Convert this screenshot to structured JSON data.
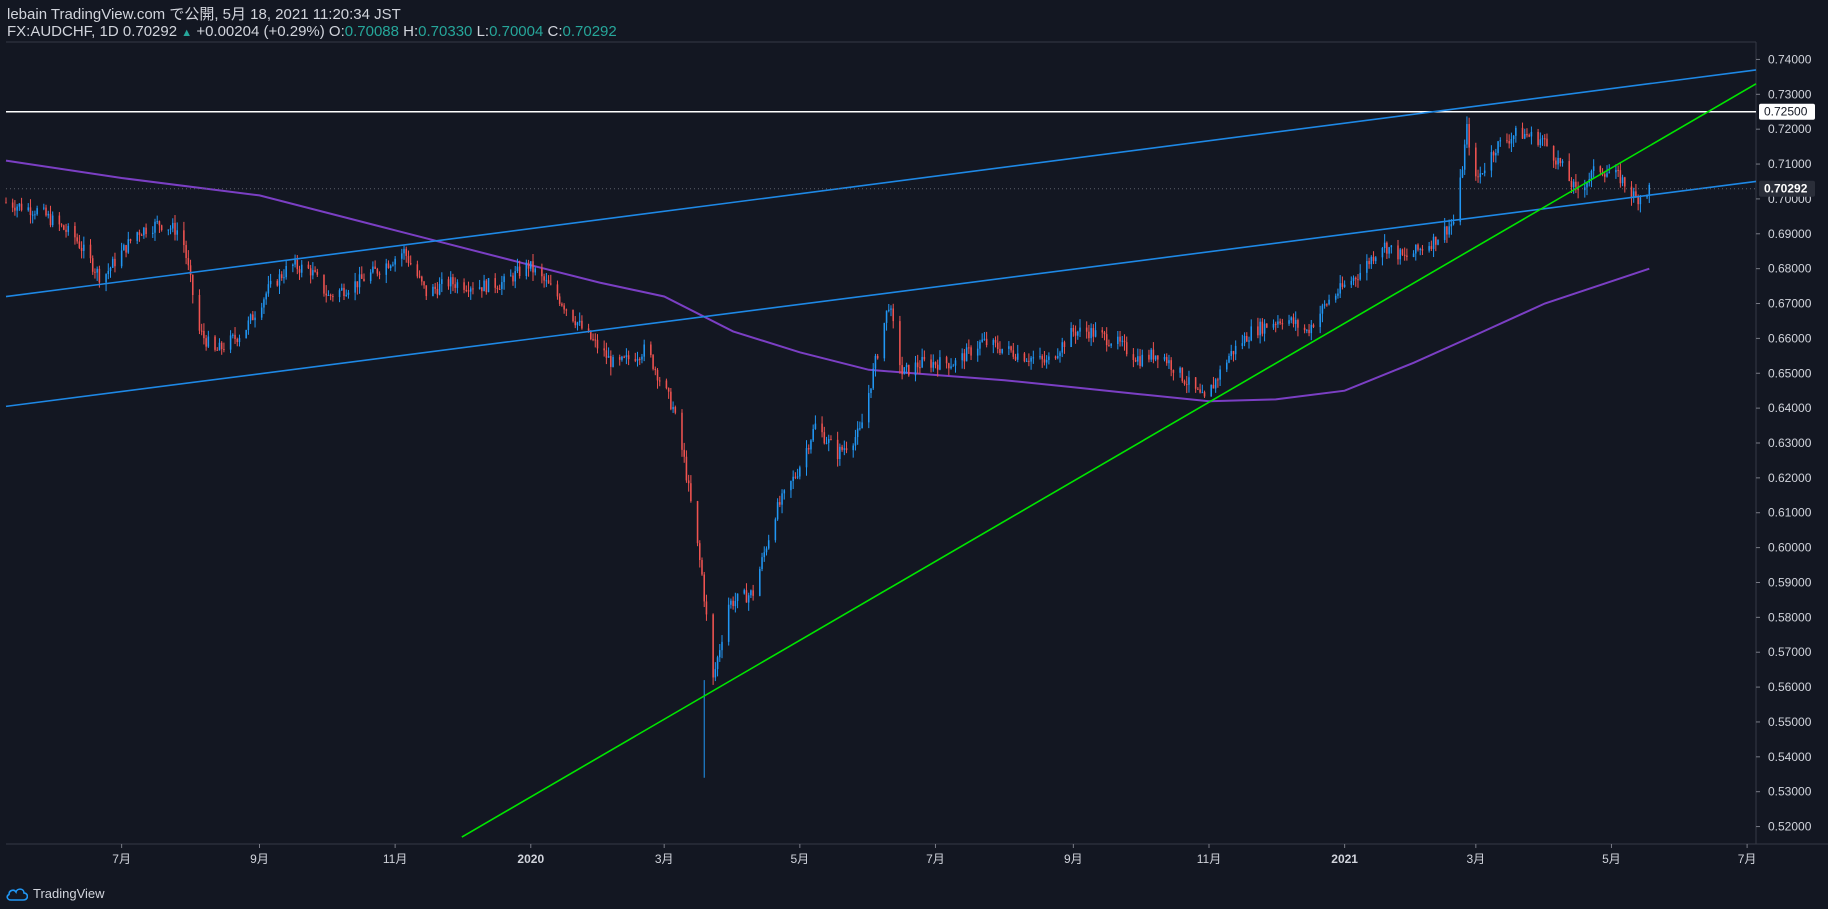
{
  "header": {
    "line1": "lebain TradingView.com で公開, 5月 18, 2021 11:20:34 JST",
    "symbol": "FX:AUDCHF, 1D 0.70292",
    "change_arrow": "▲",
    "change": "+0.00204 (+0.29%)",
    "o_label": "O:",
    "o_value": "0.70088",
    "h_label": "H:",
    "h_value": "0.70330",
    "l_label": "L:",
    "l_value": "0.70004",
    "c_label": "C:",
    "c_value": "0.70292"
  },
  "footer": {
    "brand": "TradingView"
  },
  "colors": {
    "background": "#131722",
    "up": "#2196f3",
    "down": "#ef5350",
    "ma": "#7b3fc4",
    "channel": "#1e88e5",
    "trend": "#00e600",
    "hline": "#ffffff",
    "axis_text": "#d1d4dc",
    "green_text": "#26a69a"
  },
  "chart_data": {
    "type": "candlestick",
    "symbol": "FX:AUDCHF",
    "interval": "1D",
    "ylim": [
      0.515,
      0.745
    ],
    "y_ticks": [
      "0.74000",
      "0.73000",
      "0.72000",
      "0.71000",
      "0.70000",
      "0.69000",
      "0.68000",
      "0.67000",
      "0.66000",
      "0.65000",
      "0.64000",
      "0.63000",
      "0.62000",
      "0.61000",
      "0.60000",
      "0.59000",
      "0.58000",
      "0.57000",
      "0.56000",
      "0.55000",
      "0.54000",
      "0.53000",
      "0.52000"
    ],
    "x_range": [
      "2019-05-10",
      "2021-07-05"
    ],
    "x_ticks": [
      {
        "date": "2019-07-01",
        "label": "7月"
      },
      {
        "date": "2019-09-01",
        "label": "9月"
      },
      {
        "date": "2019-11-01",
        "label": "11月"
      },
      {
        "date": "2020-01-01",
        "label": "2020"
      },
      {
        "date": "2020-03-01",
        "label": "3月"
      },
      {
        "date": "2020-05-01",
        "label": "5月"
      },
      {
        "date": "2020-07-01",
        "label": "7月"
      },
      {
        "date": "2020-09-01",
        "label": "9月"
      },
      {
        "date": "2020-11-01",
        "label": "11月"
      },
      {
        "date": "2021-01-01",
        "label": "2021"
      },
      {
        "date": "2021-03-01",
        "label": "3月"
      },
      {
        "date": "2021-05-01",
        "label": "5月"
      },
      {
        "date": "2021-07-01",
        "label": "7月"
      }
    ],
    "price_path": [
      [
        "2019-05-10",
        0.699
      ],
      [
        "2019-05-25",
        0.6965
      ],
      [
        "2019-06-10",
        0.689
      ],
      [
        "2019-06-22",
        0.677
      ],
      [
        "2019-07-08",
        0.6905
      ],
      [
        "2019-07-18",
        0.693
      ],
      [
        "2019-07-28",
        0.6905
      ],
      [
        "2019-08-05",
        0.662
      ],
      [
        "2019-08-12",
        0.656
      ],
      [
        "2019-08-25",
        0.662
      ],
      [
        "2019-09-05",
        0.674
      ],
      [
        "2019-09-15",
        0.681
      ],
      [
        "2019-09-24",
        0.6795
      ],
      [
        "2019-10-02",
        0.672
      ],
      [
        "2019-10-15",
        0.676
      ],
      [
        "2019-10-25",
        0.68
      ],
      [
        "2019-11-05",
        0.685
      ],
      [
        "2019-11-15",
        0.673
      ],
      [
        "2019-11-25",
        0.676
      ],
      [
        "2019-12-10",
        0.675
      ],
      [
        "2019-12-20",
        0.676
      ],
      [
        "2019-12-31",
        0.681
      ],
      [
        "2020-01-12",
        0.673
      ],
      [
        "2020-01-25",
        0.662
      ],
      [
        "2020-02-08",
        0.652
      ],
      [
        "2020-02-22",
        0.657
      ],
      [
        "2020-03-05",
        0.64
      ],
      [
        "2020-03-10",
        0.625
      ],
      [
        "2020-03-18",
        0.592
      ],
      [
        "2020-03-23",
        0.562
      ],
      [
        "2020-03-30",
        0.584
      ],
      [
        "2020-04-10",
        0.587
      ],
      [
        "2020-04-20",
        0.61
      ],
      [
        "2020-04-30",
        0.622
      ],
      [
        "2020-05-08",
        0.635
      ],
      [
        "2020-05-18",
        0.627
      ],
      [
        "2020-05-28",
        0.633
      ],
      [
        "2020-06-05",
        0.656
      ],
      [
        "2020-06-10",
        0.67
      ],
      [
        "2020-06-16",
        0.65
      ],
      [
        "2020-06-25",
        0.653
      ],
      [
        "2020-07-10",
        0.653
      ],
      [
        "2020-07-22",
        0.659
      ],
      [
        "2020-08-05",
        0.656
      ],
      [
        "2020-08-20",
        0.653
      ],
      [
        "2020-09-01",
        0.662
      ],
      [
        "2020-09-08",
        0.662
      ],
      [
        "2020-09-20",
        0.659
      ],
      [
        "2020-10-01",
        0.654
      ],
      [
        "2020-10-10",
        0.656
      ],
      [
        "2020-10-20",
        0.649
      ],
      [
        "2020-10-30",
        0.642
      ],
      [
        "2020-11-10",
        0.655
      ],
      [
        "2020-11-20",
        0.662
      ],
      [
        "2020-12-05",
        0.666
      ],
      [
        "2020-12-15",
        0.662
      ],
      [
        "2020-12-25",
        0.671
      ],
      [
        "2021-01-08",
        0.679
      ],
      [
        "2021-01-18",
        0.687
      ],
      [
        "2021-01-28",
        0.683
      ],
      [
        "2021-02-10",
        0.688
      ],
      [
        "2021-02-20",
        0.694
      ],
      [
        "2021-02-25",
        0.72
      ],
      [
        "2021-03-01",
        0.705
      ],
      [
        "2021-03-10",
        0.715
      ],
      [
        "2021-03-20",
        0.719
      ],
      [
        "2021-03-31",
        0.717
      ],
      [
        "2021-04-08",
        0.71
      ],
      [
        "2021-04-15",
        0.702
      ],
      [
        "2021-04-25",
        0.709
      ],
      [
        "2021-05-05",
        0.706
      ],
      [
        "2021-05-12",
        0.7
      ],
      [
        "2021-05-18",
        0.7029
      ]
    ],
    "moving_average": [
      [
        "2019-05-10",
        0.711
      ],
      [
        "2019-07-01",
        0.706
      ],
      [
        "2019-09-01",
        0.701
      ],
      [
        "2019-11-01",
        0.691
      ],
      [
        "2020-01-01",
        0.681
      ],
      [
        "2020-02-01",
        0.676
      ],
      [
        "2020-03-01",
        0.672
      ],
      [
        "2020-04-01",
        0.662
      ],
      [
        "2020-05-01",
        0.656
      ],
      [
        "2020-06-01",
        0.651
      ],
      [
        "2020-07-01",
        0.6495
      ],
      [
        "2020-08-01",
        0.648
      ],
      [
        "2020-09-01",
        0.646
      ],
      [
        "2020-10-01",
        0.644
      ],
      [
        "2020-11-01",
        0.642
      ],
      [
        "2020-12-01",
        0.6425
      ],
      [
        "2021-01-01",
        0.645
      ],
      [
        "2021-02-01",
        0.653
      ],
      [
        "2021-03-01",
        0.661
      ],
      [
        "2021-04-01",
        0.67
      ],
      [
        "2021-05-18",
        0.68
      ]
    ],
    "drawings": [
      {
        "type": "horizontal-line",
        "name": "resistance-line",
        "price": 0.725,
        "label": "0.72500"
      },
      {
        "type": "trend-line",
        "name": "channel-upper",
        "from": [
          "2019-05-10",
          0.672
        ],
        "to": [
          "2021-07-05",
          0.737
        ]
      },
      {
        "type": "trend-line",
        "name": "channel-lower",
        "from": [
          "2019-05-10",
          0.6405
        ],
        "to": [
          "2021-07-05",
          0.705
        ]
      },
      {
        "type": "trend-line",
        "name": "rising-trendline",
        "from": [
          "2019-12-01",
          0.517
        ],
        "to": [
          "2021-07-05",
          0.733
        ]
      }
    ],
    "last_price_label": "0.70292",
    "grid": false
  }
}
